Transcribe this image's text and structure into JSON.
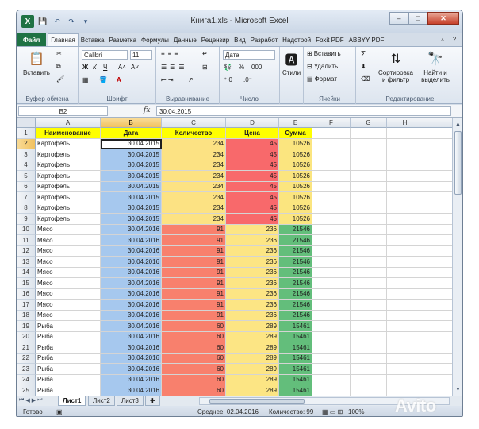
{
  "window": {
    "title": "Книга1.xls - Microsoft Excel",
    "buttons": {
      "minimize": "–",
      "maximize": "□",
      "close": "✕"
    }
  },
  "qat": {
    "logo": "X",
    "save": "💾",
    "undo": "↶",
    "redo": "↷",
    "customize": "▾"
  },
  "tabs": [
    "Главная",
    "Вставка",
    "Разметка",
    "Формулы",
    "Данные",
    "Рецензир",
    "Вид",
    "Разработ",
    "Надстрой",
    "Foxit PDF",
    "ABBYY PDF"
  ],
  "file_tab": "Файл",
  "ribbon": {
    "clipboard": {
      "paste": "Вставить",
      "label": "Буфер обмена"
    },
    "font": {
      "name": "Calibri",
      "size": "11",
      "label": "Шрифт",
      "bold": "Ж",
      "italic": "К",
      "underline": "Ч",
      "grow": "A˄",
      "shrink": "A˅",
      "fill": "A"
    },
    "alignment": {
      "label": "Выравнивание"
    },
    "number": {
      "format": "Дата",
      "percent": "%",
      "thousands": "000",
      "label": "Число"
    },
    "styles": {
      "label": "Стили"
    },
    "cells": {
      "insert": "Вставить",
      "delete": "Удалить",
      "format": "Формат",
      "label": "Ячейки"
    },
    "editing": {
      "sigma": "Σ",
      "sort": "Сортировка и фильтр",
      "find": "Найти и выделить",
      "label": "Редактирование"
    }
  },
  "formula": {
    "namebox": "B2",
    "fx": "fx",
    "value": "30.04.2015"
  },
  "columns": [
    "A",
    "B",
    "C",
    "D",
    "E",
    "F",
    "G",
    "H",
    "I"
  ],
  "header_row": [
    "Наименование",
    "Дата",
    "Количество",
    "Цена",
    "Сумма"
  ],
  "rows": [
    [
      "Картофель",
      "30.04.2015",
      "234",
      "45",
      "10526"
    ],
    [
      "Картофель",
      "30.04.2015",
      "234",
      "45",
      "10526"
    ],
    [
      "Картофель",
      "30.04.2015",
      "234",
      "45",
      "10526"
    ],
    [
      "Картофель",
      "30.04.2015",
      "234",
      "45",
      "10526"
    ],
    [
      "Картофель",
      "30.04.2015",
      "234",
      "45",
      "10526"
    ],
    [
      "Картофель",
      "30.04.2015",
      "234",
      "45",
      "10526"
    ],
    [
      "Картофель",
      "30.04.2015",
      "234",
      "45",
      "10526"
    ],
    [
      "Картофель",
      "30.04.2015",
      "234",
      "45",
      "10526"
    ],
    [
      "Мясо",
      "30.04.2016",
      "91",
      "236",
      "21546"
    ],
    [
      "Мясо",
      "30.04.2016",
      "91",
      "236",
      "21546"
    ],
    [
      "Мясо",
      "30.04.2016",
      "91",
      "236",
      "21546"
    ],
    [
      "Мясо",
      "30.04.2016",
      "91",
      "236",
      "21546"
    ],
    [
      "Мясо",
      "30.04.2016",
      "91",
      "236",
      "21546"
    ],
    [
      "Мясо",
      "30.04.2016",
      "91",
      "236",
      "21546"
    ],
    [
      "Мясо",
      "30.04.2016",
      "91",
      "236",
      "21546"
    ],
    [
      "Мясо",
      "30.04.2016",
      "91",
      "236",
      "21546"
    ],
    [
      "Мясо",
      "30.04.2016",
      "91",
      "236",
      "21546"
    ],
    [
      "Рыба",
      "30.04.2016",
      "60",
      "289",
      "15461"
    ],
    [
      "Рыба",
      "30.04.2016",
      "60",
      "289",
      "15461"
    ],
    [
      "Рыба",
      "30.04.2016",
      "60",
      "289",
      "15461"
    ],
    [
      "Рыба",
      "30.04.2016",
      "60",
      "289",
      "15461"
    ],
    [
      "Рыба",
      "30.04.2016",
      "60",
      "289",
      "15461"
    ],
    [
      "Рыба",
      "30.04.2016",
      "60",
      "289",
      "15461"
    ],
    [
      "Рыба",
      "30.04.2016",
      "60",
      "289",
      "15461"
    ]
  ],
  "colors": {
    "header_fill": "#ffff00",
    "date_fill": "#a6c8ee",
    "qty_yellow": "#fce283",
    "qty_red": "#f8806d",
    "price_red": "#f8696b",
    "price_yellow": "#fce584",
    "sum_yellow": "#fbe57f",
    "sum_green": "#63be7b"
  },
  "sheets": [
    "Лист1",
    "Лист2",
    "Лист3"
  ],
  "status": {
    "ready": "Готово",
    "average": "Среднее: 02.04.2016",
    "count": "Количество: 99",
    "zoom": "100%"
  },
  "watermark": "Avito"
}
